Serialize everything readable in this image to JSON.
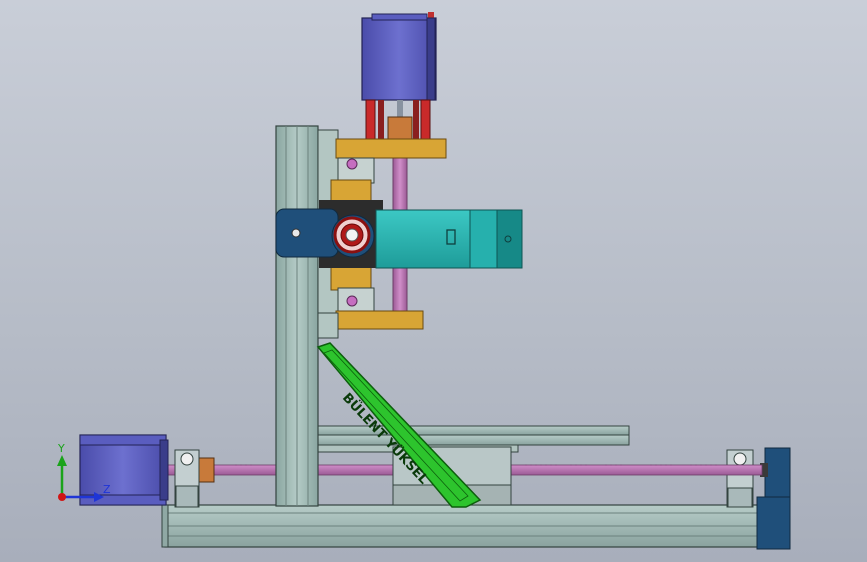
{
  "model": {
    "brace_text": "BÜLENT YÜKSEL"
  },
  "triad": {
    "y_label": "Y",
    "z_label": "Z",
    "y_color": "#1aa31a",
    "z_color": "#1f35d6",
    "origin_color": "#d01515"
  },
  "colors": {
    "background": "#bcc2cc",
    "aluminum": "#9fb8b3",
    "aluminum_dark": "#5f7773",
    "motor": "#5c5fbf",
    "motor_dark": "#3b3d8a",
    "leadscrew": "#c07ab8",
    "carriage_plate": "#d8a535",
    "spindle": "#2bb3b0",
    "mount_block": "#1f4f7a",
    "coupler": "#c87a3a",
    "brace": "#2dc42d",
    "rail_support": "#b8c4c6"
  }
}
